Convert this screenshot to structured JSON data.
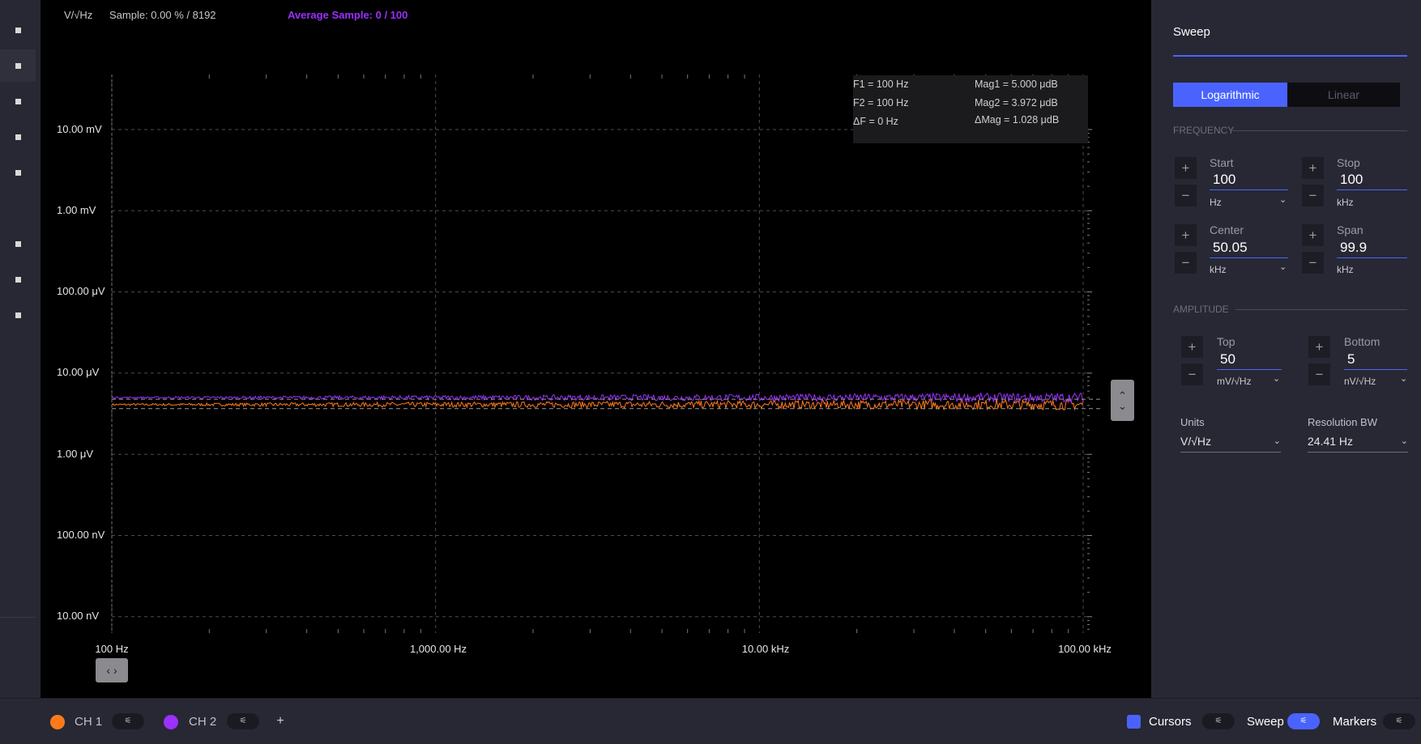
{
  "plot": {
    "units_label": "V/√Hz",
    "sample_text": "Sample: 0.00 % / 8192",
    "average_text": "Average Sample: 0 / 100",
    "y_ticks": [
      "10.00 mV",
      "1.00 mV",
      "100.00 μV",
      "10.00 μV",
      "1.00 μV",
      "100.00 nV",
      "10.00 nV"
    ],
    "x_ticks": [
      "100 Hz",
      "1,000.00 Hz",
      "10.00 kHz",
      "100.00 kHz"
    ],
    "readout": {
      "f1": "F1 =  100 Hz",
      "f2": "F2 =  100 Hz",
      "df": "ΔF =  0 Hz",
      "mag1": "Mag1 =  5.000 μdB",
      "mag2": "Mag2 =  3.972 μdB",
      "dmag": "ΔMag =  1.028 μdB"
    },
    "vscroll_up": "⌃",
    "vscroll_down": "⌄",
    "hscroll_label": "‹ ›",
    "trace_colors": {
      "ch1": "#ff7a1a",
      "ch2": "#9b30ff"
    },
    "grid_color": "#4d4d4d"
  },
  "chart_data": {
    "type": "line",
    "title": "",
    "xlabel": "",
    "ylabel": "V/√Hz",
    "x_scale": "log",
    "y_scale": "log",
    "xlim": [
      "100 Hz",
      "100.00 kHz"
    ],
    "ylim": [
      "10.00 nV",
      "10.00 mV"
    ],
    "grid": true,
    "series": [
      {
        "name": "CH 1",
        "color": "#ff7a1a",
        "level_uV": 4.1,
        "noise": 0.08
      },
      {
        "name": "CH 2",
        "color": "#9b30ff",
        "level_uV": 5.0,
        "noise": 0.07
      }
    ]
  },
  "panel": {
    "title": "Sweep",
    "scale_options": [
      "Logarithmic",
      "Linear"
    ],
    "frequency_section": "FREQUENCY",
    "amplitude_section": "AMPLITUDE",
    "start": {
      "label": "Start",
      "value": "100",
      "unit": "Hz"
    },
    "stop": {
      "label": "Stop",
      "value": "100",
      "unit": "kHz"
    },
    "center": {
      "label": "Center",
      "value": "50.05",
      "unit": "kHz"
    },
    "span": {
      "label": "Span",
      "value": "99.9",
      "unit": "kHz"
    },
    "top": {
      "label": "Top",
      "value": "50",
      "unit": "mV/√Hz"
    },
    "bottom": {
      "label": "Bottom",
      "value": "5",
      "unit": "nV/√Hz"
    },
    "units": {
      "label": "Units",
      "value": "V/√Hz"
    },
    "resolution": {
      "label": "Resolution BW",
      "value": "24.41 Hz"
    },
    "plus": "+",
    "minus": "−",
    "chevron": "⌄"
  },
  "bottom": {
    "ch1": {
      "label": "CH 1",
      "color": "#ff7a1a"
    },
    "ch2": {
      "label": "CH 2",
      "color": "#9b30ff"
    },
    "add": "+",
    "cursors": "Cursors",
    "sweep": "Sweep",
    "markers": "Markers",
    "settings_glyph": "⚟",
    "accent": "#4a63ff"
  }
}
